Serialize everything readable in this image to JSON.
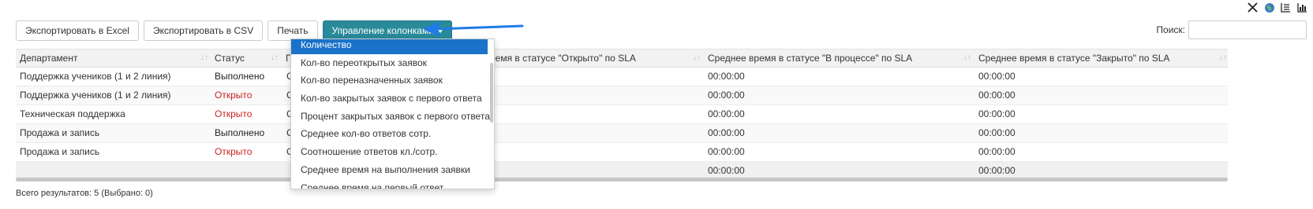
{
  "toolbar": {
    "export_excel": "Экспортировать в Excel",
    "export_csv": "Экспортировать в CSV",
    "print": "Печать",
    "columns": "Управление колонками"
  },
  "search": {
    "label": "Поиск:",
    "value": ""
  },
  "top_icons": [
    "close-icon",
    "globe-icon",
    "list-icon",
    "bar-chart-icon"
  ],
  "accent_color": "#2a8a9a",
  "columns": {
    "department": "Департамент",
    "status": "Статус",
    "open_sla": "ремя в статусе \"Открыто\" по SLA",
    "progress_sla": "Среднее время в статусе \"В процессе\" по SLA",
    "closed_sla": "Среднее время в статусе \"Закрыто\" по SLA"
  },
  "rows": [
    {
      "department": "Поддержка учеников (1 и 2 линия)",
      "status": "Выполнено",
      "c3": "C",
      "progress": "00:00:00",
      "closed": "00:00:00"
    },
    {
      "department": "Поддержка учеников (1 и 2 линия)",
      "status": "Открыто",
      "c3": "C",
      "progress": "00:00:00",
      "closed": "00:00:00"
    },
    {
      "department": "Техническая поддержка",
      "status": "Открыто",
      "c3": "C",
      "progress": "00:00:00",
      "closed": "00:00:00"
    },
    {
      "department": "Продажа и запись",
      "status": "Выполнено",
      "c3": "C",
      "progress": "00:00:00",
      "closed": "00:00:00"
    },
    {
      "department": "Продажа и запись",
      "status": "Открыто",
      "c3": "C",
      "progress": "00:00:00",
      "closed": "00:00:00"
    }
  ],
  "totals": {
    "progress": "00:00:00",
    "closed": "00:00:00"
  },
  "dropdown": {
    "items": [
      "Количество",
      "Кол-во переоткрытых заявок",
      "Кол-во переназначенных заявок",
      "Кол-во закрытых заявок с первого ответа",
      "Процент закрытых заявок с первого ответа",
      "Среднее кол-во ответов сотр.",
      "Соотношение ответов кл./сотр.",
      "Среднее время на выполнения заявки",
      "Среднее время на первый ответ"
    ]
  },
  "footer": "Всего результатов: 5 (Выбрано: 0)"
}
